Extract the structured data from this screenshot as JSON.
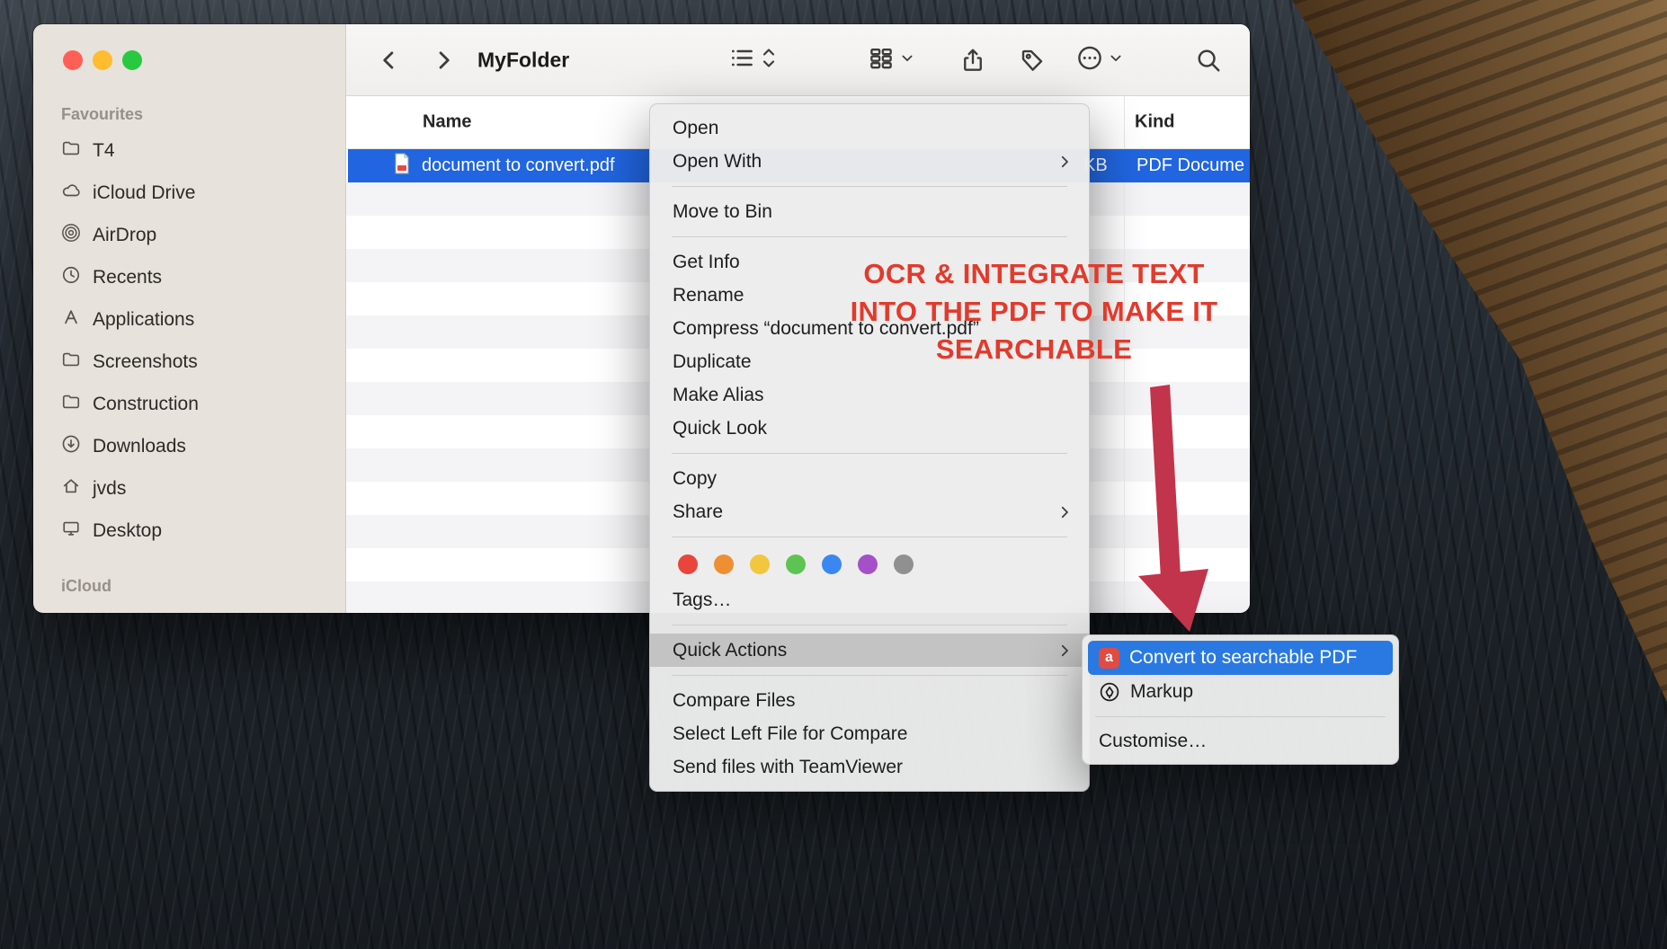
{
  "theme": {
    "accent_blue": "#2165e0",
    "submenu_blue": "#2a79e3",
    "annotation_red": "#e23a2c",
    "arrow_red": "#c2344b",
    "sidebar_bg": "#e7e2db",
    "traffic_red": "#ff5f57",
    "traffic_yellow": "#febc2e",
    "traffic_green": "#28c840"
  },
  "window": {
    "title": "MyFolder"
  },
  "sidebar": {
    "sections": [
      {
        "header": "Favourites",
        "items": [
          {
            "label": "T4",
            "icon": "folder-icon"
          },
          {
            "label": "iCloud Drive",
            "icon": "cloud-icon"
          },
          {
            "label": "AirDrop",
            "icon": "airdrop-icon"
          },
          {
            "label": "Recents",
            "icon": "clock-icon"
          },
          {
            "label": "Applications",
            "icon": "applications-icon"
          },
          {
            "label": "Screenshots",
            "icon": "folder-icon"
          },
          {
            "label": "Construction",
            "icon": "folder-icon"
          },
          {
            "label": "Downloads",
            "icon": "downloads-icon"
          },
          {
            "label": "jvds",
            "icon": "home-icon"
          },
          {
            "label": "Desktop",
            "icon": "desktop-icon"
          }
        ]
      },
      {
        "header": "iCloud",
        "items": []
      }
    ]
  },
  "file_list": {
    "columns": {
      "name": "Name",
      "kind": "Kind"
    },
    "row": {
      "name": "document to convert.pdf",
      "size": "KB",
      "kind": "PDF Docume"
    }
  },
  "context_menu": {
    "groups": [
      {
        "items": [
          {
            "label": "Open"
          },
          {
            "label": "Open With",
            "submenu": true
          }
        ]
      },
      {
        "items": [
          {
            "label": "Move to Bin"
          }
        ]
      },
      {
        "items": [
          {
            "label": "Get Info"
          },
          {
            "label": "Rename"
          },
          {
            "label": "Compress “document to convert.pdf”"
          },
          {
            "label": "Duplicate"
          },
          {
            "label": "Make Alias"
          },
          {
            "label": "Quick Look"
          }
        ]
      },
      {
        "items": [
          {
            "label": "Copy"
          },
          {
            "label": "Share",
            "submenu": true
          }
        ]
      },
      {
        "items": [
          {
            "label": "Tags…"
          }
        ]
      },
      {
        "items": [
          {
            "label": "Quick Actions",
            "submenu": true,
            "highlighted": true
          }
        ]
      },
      {
        "items": [
          {
            "label": "Compare Files"
          },
          {
            "label": "Select Left File for Compare"
          },
          {
            "label": "Send files with TeamViewer"
          }
        ]
      }
    ],
    "tag_colors": [
      "#e8453c",
      "#ee8f34",
      "#f2c63e",
      "#5dc454",
      "#3a87f2",
      "#a550c8",
      "#909090"
    ]
  },
  "quick_actions_submenu": {
    "items": [
      {
        "label": "Convert to searchable PDF",
        "selected": true,
        "icon": "searchable-pdf-icon"
      },
      {
        "label": "Markup",
        "icon": "markup-icon"
      }
    ],
    "customise_label": "Customise…"
  },
  "annotation": {
    "lines": [
      "OCR & INTEGRATE TEXT",
      "INTO THE PDF TO MAKE IT",
      "SEARCHABLE"
    ]
  }
}
